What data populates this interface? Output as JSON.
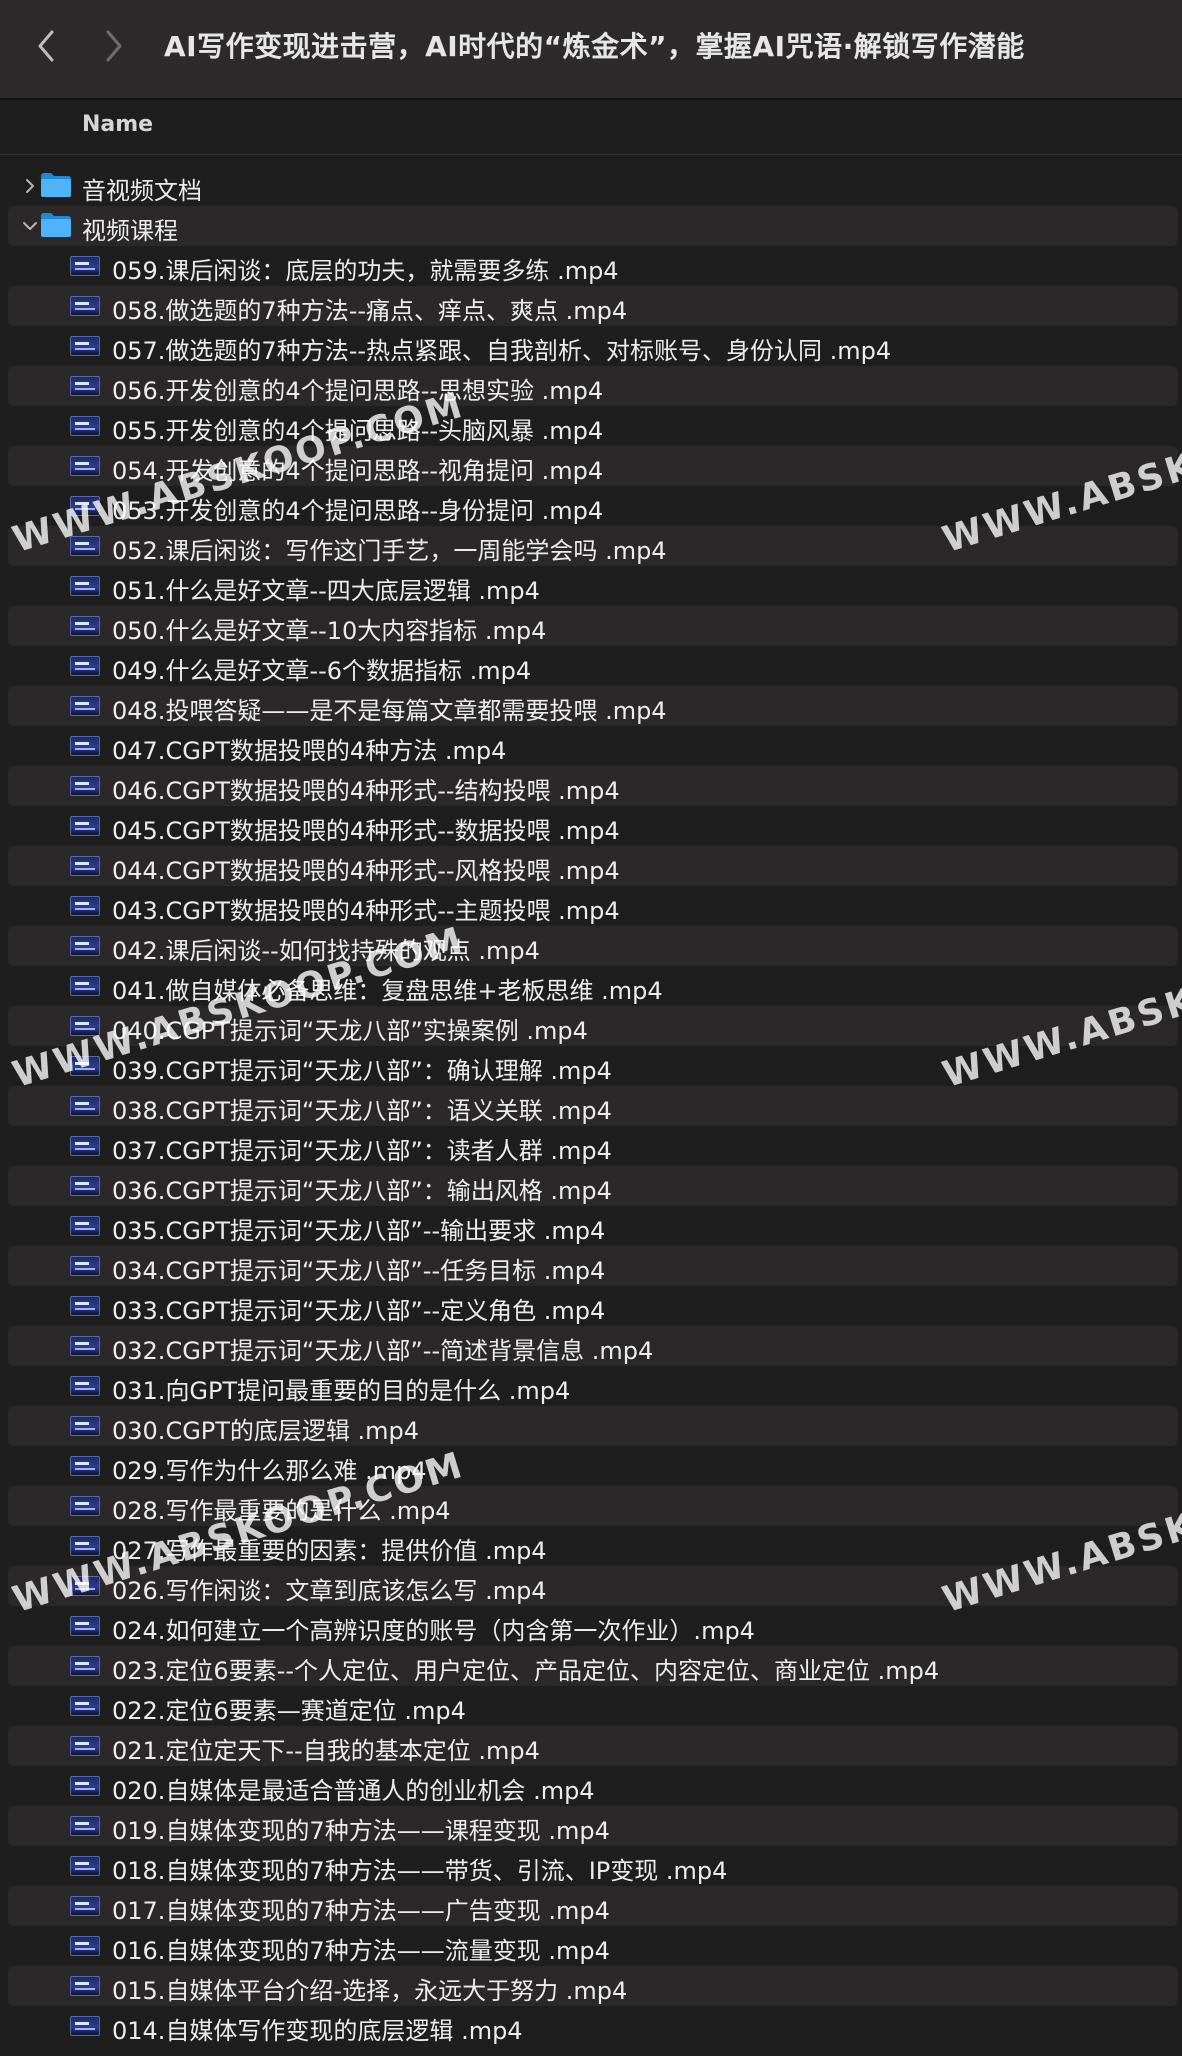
{
  "window": {
    "title": "AI写作变现进击营，AI时代的“炼金术”，掌握AI咒语·解锁写作潜能"
  },
  "columns": {
    "name": "Name"
  },
  "folders": [
    {
      "label": "音视频文档",
      "expanded": false
    },
    {
      "label": "视频课程",
      "expanded": true
    }
  ],
  "files": [
    "059.课后闲谈：底层的功夫，就需要多练 .mp4",
    "058.做选题的7种方法--痛点、痒点、爽点 .mp4",
    "057.做选题的7种方法--热点紧跟、自我剖析、对标账号、身份认同 .mp4",
    "056.开发创意的4个提问思路--思想实验 .mp4",
    "055.开发创意的4个提问思路--头脑风暴 .mp4",
    "054.开发创意的4个提问思路--视角提问 .mp4",
    "053.开发创意的4个提问思路--身份提问 .mp4",
    "052.课后闲谈：写作这门手艺，一周能学会吗 .mp4",
    "051.什么是好文章--四大底层逻辑 .mp4",
    "050.什么是好文章--10大内容指标 .mp4",
    "049.什么是好文章--6个数据指标 .mp4",
    "048.投喂答疑——是不是每篇文章都需要投喂 .mp4",
    "047.CGPT数据投喂的4种方法 .mp4",
    "046.CGPT数据投喂的4种形式--结构投喂 .mp4",
    "045.CGPT数据投喂的4种形式--数据投喂 .mp4",
    "044.CGPT数据投喂的4种形式--风格投喂 .mp4",
    "043.CGPT数据投喂的4种形式--主题投喂 .mp4",
    "042.课后闲谈--如何找持殊的观点 .mp4",
    "041.做自媒体必备思维：复盘思维+老板思维 .mp4",
    "040.CGPT提示词“天龙八部”实操案例 .mp4",
    "039.CGPT提示词“天龙八部”：确认理解 .mp4",
    "038.CGPT提示词“天龙八部”：语义关联 .mp4",
    "037.CGPT提示词“天龙八部”：读者人群 .mp4",
    "036.CGPT提示词“天龙八部”：输出风格 .mp4",
    "035.CGPT提示词“天龙八部”--输出要求 .mp4",
    "034.CGPT提示词“天龙八部”--任务目标 .mp4",
    "033.CGPT提示词“天龙八部”--定义角色 .mp4",
    "032.CGPT提示词“天龙八部”--简述背景信息 .mp4",
    "031.向GPT提问最重要的目的是什么 .mp4",
    "030.CGPT的底层逻辑 .mp4",
    "029.写作为什么那么难 .mp4",
    "028.写作最重要的是什么 .mp4",
    "027.写作最重要的因素：提供价值 .mp4",
    "026.写作闲谈：文章到底该怎么写 .mp4",
    "024.如何建立一个高辨识度的账号（内含第一次作业）.mp4",
    "023.定位6要素--个人定位、用户定位、产品定位、内容定位、商业定位 .mp4",
    "022.定位6要素—赛道定位 .mp4",
    "021.定位定天下--自我的基本定位 .mp4",
    "020.自媒体是最适合普通人的创业机会 .mp4",
    "019.自媒体变现的7种方法——课程变现 .mp4",
    "018.自媒体变现的7种方法——带货、引流、IP变现 .mp4",
    "017.自媒体变现的7种方法——广告变现 .mp4",
    "016.自媒体变现的7种方法——流量变现 .mp4",
    "015.自媒体平台介绍-选择，永远大于努力 .mp4",
    "014.自媒体写作变现的底层逻辑 .mp4"
  ],
  "watermark": {
    "text_left": "WWW.ABSKOOP.COM",
    "text_right": "WWW.ABSK"
  }
}
